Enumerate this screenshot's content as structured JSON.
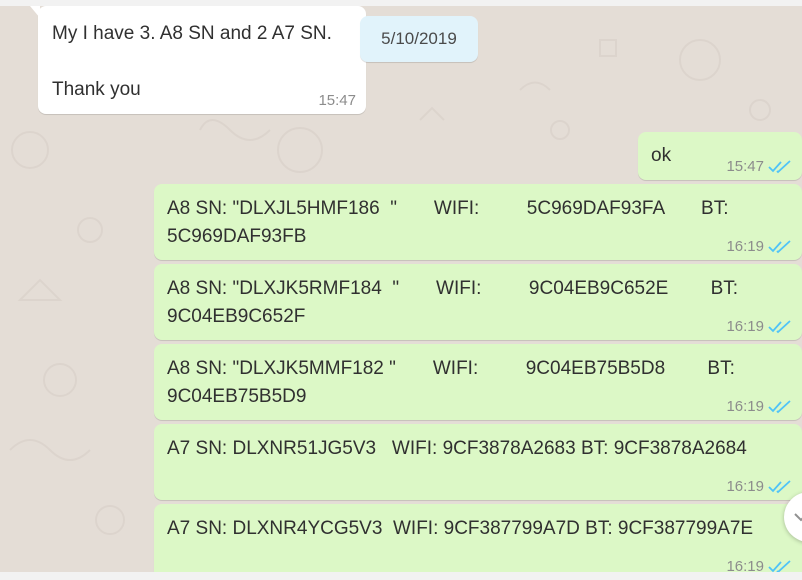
{
  "date_chip": "5/10/2019",
  "messages": [
    {
      "direction": "in",
      "lines": [
        "My I have 3. A8 SN and 2 A7 SN.",
        "",
        "Thank you"
      ],
      "time": "15:47"
    },
    {
      "direction": "out",
      "lines": [
        "ok"
      ],
      "time": "15:47",
      "status": "read"
    },
    {
      "direction": "out",
      "lines": [
        "A8 SN: \"DLXJL5HMF186  \"       WIFI:         5C969DAF93FA       BT:",
        "5C969DAF93FB"
      ],
      "time": "16:19",
      "status": "read"
    },
    {
      "direction": "out",
      "lines": [
        "A8 SN: \"DLXJK5RMF184  \"       WIFI:         9C04EB9C652E        BT:",
        "9C04EB9C652F"
      ],
      "time": "16:19",
      "status": "read"
    },
    {
      "direction": "out",
      "lines": [
        "A8 SN: \"DLXJK5MMF182 \"       WIFI:         9C04EB75B5D8        BT:",
        "9C04EB75B5D9"
      ],
      "time": "16:19",
      "status": "read"
    },
    {
      "direction": "out",
      "lines": [
        "A7 SN: DLXNR51JG5V3   WIFI: 9CF3878A2683 BT: 9CF3878A2684"
      ],
      "time": "16:19",
      "status": "read"
    },
    {
      "direction": "out",
      "lines": [
        "A7 SN: DLXNR4YCG5V3  WIFI: 9CF387799A7D BT: 9CF387799A7E"
      ],
      "time": "16:19",
      "status": "read"
    }
  ],
  "icons": {
    "read_receipt": "double-check-icon",
    "scroll_down": "chevron-down-icon"
  },
  "colors": {
    "incoming": "#ffffff",
    "outgoing": "#dcf8c6",
    "chat_bg": "#e4ddd6",
    "read_tick": "#4fc3f7",
    "date_chip": "#e1f3fb"
  }
}
